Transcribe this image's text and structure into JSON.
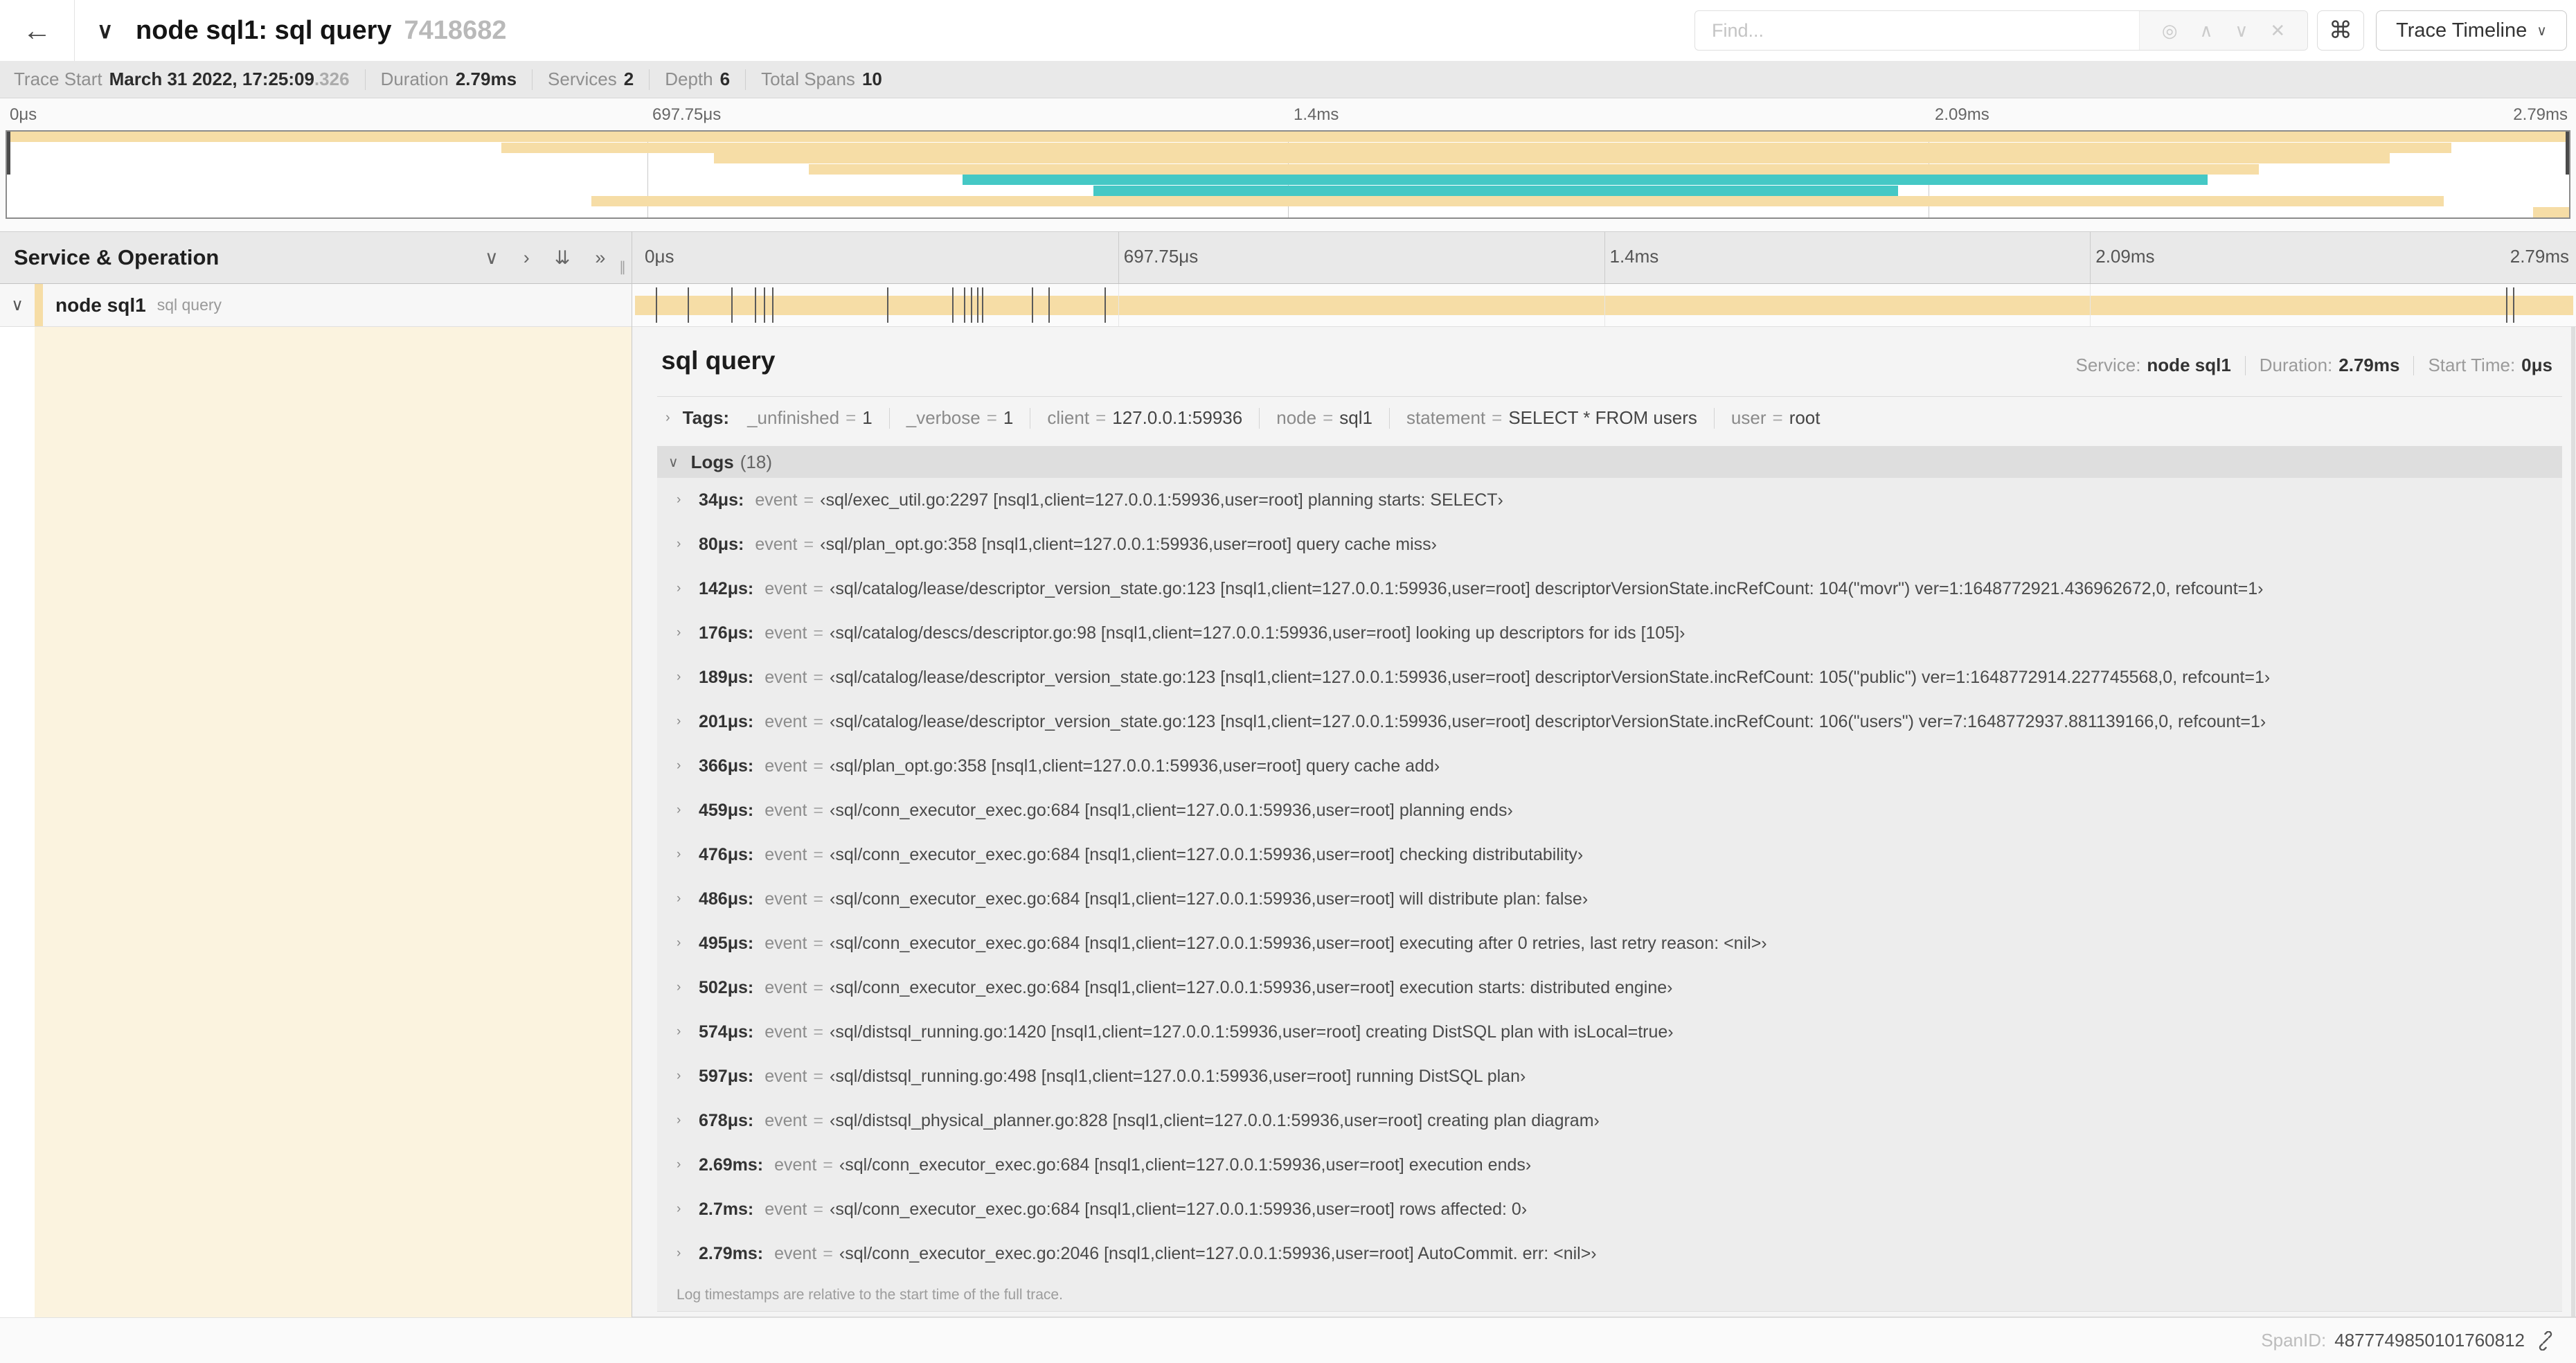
{
  "colors": {
    "span_tan": "#f6dda6",
    "span_teal": "#45c8c5",
    "cream": "#fbf3df"
  },
  "topbar": {
    "back_icon": "←",
    "collapse_icon": "∨",
    "title": "node sql1: sql query",
    "trace_id": "7418682",
    "find_placeholder": "Find...",
    "icons": {
      "locate": "◎",
      "prev": "∧",
      "next": "∨",
      "clear": "✕",
      "shortcut": "⌘",
      "dropdown": "∨"
    },
    "view_selector_label": "Trace Timeline"
  },
  "summary": {
    "items": [
      {
        "label": "Trace Start",
        "value": "March 31 2022, 17:25:09",
        "suffix": ".326"
      },
      {
        "label": "Duration",
        "value": "2.79ms",
        "suffix": ""
      },
      {
        "label": "Services",
        "value": "2",
        "suffix": ""
      },
      {
        "label": "Depth",
        "value": "6",
        "suffix": ""
      },
      {
        "label": "Total Spans",
        "value": "10",
        "suffix": ""
      }
    ]
  },
  "minimap": {
    "spans": [
      {
        "row": 0,
        "start": 0,
        "end": 1,
        "color": "tan"
      },
      {
        "row": 1,
        "start": 0.193,
        "end": 0.954,
        "color": "tan"
      },
      {
        "row": 2,
        "start": 0.276,
        "end": 0.93,
        "color": "tan"
      },
      {
        "row": 3,
        "start": 0.313,
        "end": 0.879,
        "color": "tan"
      },
      {
        "row": 4,
        "start": 0.373,
        "end": 0.859,
        "color": "teal"
      },
      {
        "row": 5,
        "start": 0.424,
        "end": 0.738,
        "color": "teal"
      },
      {
        "row": 6,
        "start": 0.228,
        "end": 0.951,
        "color": "tan"
      },
      {
        "row": 7,
        "start": 0.986,
        "end": 1,
        "color": "tan"
      }
    ]
  },
  "timeline": {
    "panel_title": "Service & Operation",
    "icons": {
      "collapse_one": "∨",
      "expand_one": "›",
      "collapse_all": "⇊",
      "expand_all": "»",
      "drag_handle": "∥"
    },
    "ticks": [
      {
        "label": "0μs",
        "pos": 0
      },
      {
        "label": "697.75μs",
        "pos": 0.25
      },
      {
        "label": "1.4ms",
        "pos": 0.5
      },
      {
        "label": "2.09ms",
        "pos": 0.75
      },
      {
        "label": "2.79ms",
        "pos": 1
      }
    ],
    "row": {
      "caret": "∨",
      "service": "node sql1",
      "operation": "sql query"
    },
    "total_us": 2790,
    "log_marks_us": [
      34,
      80,
      142,
      176,
      189,
      201,
      366,
      459,
      476,
      486,
      495,
      502,
      574,
      597,
      678,
      2690,
      2700,
      2790
    ]
  },
  "detail": {
    "operation": "sql query",
    "service_label": "Service:",
    "service": "node sql1",
    "duration_label": "Duration:",
    "duration": "2.79ms",
    "start_label": "Start Time:",
    "start_time": "0μs",
    "caret_icon": "›",
    "logs_caret_icon": "∨",
    "tags_label": "Tags:",
    "tags": [
      {
        "key": "_unfinished",
        "value": "1"
      },
      {
        "key": "_verbose",
        "value": "1"
      },
      {
        "key": "client",
        "value": "127.0.0.1:59936"
      },
      {
        "key": "node",
        "value": "sql1"
      },
      {
        "key": "statement",
        "value": "SELECT * FROM users"
      },
      {
        "key": "user",
        "value": "root"
      }
    ],
    "logs_label": "Logs",
    "logs_count": "(18)",
    "log_key_label": "event",
    "eq": "=",
    "logs": [
      {
        "time": "34μs:",
        "text": "‹sql/exec_util.go:2297 [nsql1,client=127.0.0.1:59936,user=root] planning starts: SELECT›"
      },
      {
        "time": "80μs:",
        "text": "‹sql/plan_opt.go:358 [nsql1,client=127.0.0.1:59936,user=root] query cache miss›"
      },
      {
        "time": "142μs:",
        "text": "‹sql/catalog/lease/descriptor_version_state.go:123 [nsql1,client=127.0.0.1:59936,user=root] descriptorVersionState.incRefCount: 104(\"movr\") ver=1:1648772921.436962672,0, refcount=1›"
      },
      {
        "time": "176μs:",
        "text": "‹sql/catalog/descs/descriptor.go:98 [nsql1,client=127.0.0.1:59936,user=root] looking up descriptors for ids [105]›"
      },
      {
        "time": "189μs:",
        "text": "‹sql/catalog/lease/descriptor_version_state.go:123 [nsql1,client=127.0.0.1:59936,user=root] descriptorVersionState.incRefCount: 105(\"public\") ver=1:1648772914.227745568,0, refcount=1›"
      },
      {
        "time": "201μs:",
        "text": "‹sql/catalog/lease/descriptor_version_state.go:123 [nsql1,client=127.0.0.1:59936,user=root] descriptorVersionState.incRefCount: 106(\"users\") ver=7:1648772937.881139166,0, refcount=1›"
      },
      {
        "time": "366μs:",
        "text": "‹sql/plan_opt.go:358 [nsql1,client=127.0.0.1:59936,user=root] query cache add›"
      },
      {
        "time": "459μs:",
        "text": "‹sql/conn_executor_exec.go:684 [nsql1,client=127.0.0.1:59936,user=root] planning ends›"
      },
      {
        "time": "476μs:",
        "text": "‹sql/conn_executor_exec.go:684 [nsql1,client=127.0.0.1:59936,user=root] checking distributability›"
      },
      {
        "time": "486μs:",
        "text": "‹sql/conn_executor_exec.go:684 [nsql1,client=127.0.0.1:59936,user=root] will distribute plan: false›"
      },
      {
        "time": "495μs:",
        "text": "‹sql/conn_executor_exec.go:684 [nsql1,client=127.0.0.1:59936,user=root] executing after 0 retries, last retry reason: <nil>›"
      },
      {
        "time": "502μs:",
        "text": "‹sql/conn_executor_exec.go:684 [nsql1,client=127.0.0.1:59936,user=root] execution starts: distributed engine›"
      },
      {
        "time": "574μs:",
        "text": "‹sql/distsql_running.go:1420 [nsql1,client=127.0.0.1:59936,user=root] creating DistSQL plan with isLocal=true›"
      },
      {
        "time": "597μs:",
        "text": "‹sql/distsql_running.go:498 [nsql1,client=127.0.0.1:59936,user=root] running DistSQL plan›"
      },
      {
        "time": "678μs:",
        "text": "‹sql/distsql_physical_planner.go:828 [nsql1,client=127.0.0.1:59936,user=root] creating plan diagram›"
      },
      {
        "time": "2.69ms:",
        "text": "‹sql/conn_executor_exec.go:684 [nsql1,client=127.0.0.1:59936,user=root] execution ends›"
      },
      {
        "time": "2.7ms:",
        "text": "‹sql/conn_executor_exec.go:684 [nsql1,client=127.0.0.1:59936,user=root] rows affected: 0›"
      },
      {
        "time": "2.79ms:",
        "text": "‹sql/conn_executor_exec.go:2046 [nsql1,client=127.0.0.1:59936,user=root] AutoCommit. err: <nil>›"
      }
    ],
    "footnote": "Log timestamps are relative to the start time of the full trace.",
    "spanid_label": "SpanID:",
    "spanid": "4877749850101760812"
  }
}
